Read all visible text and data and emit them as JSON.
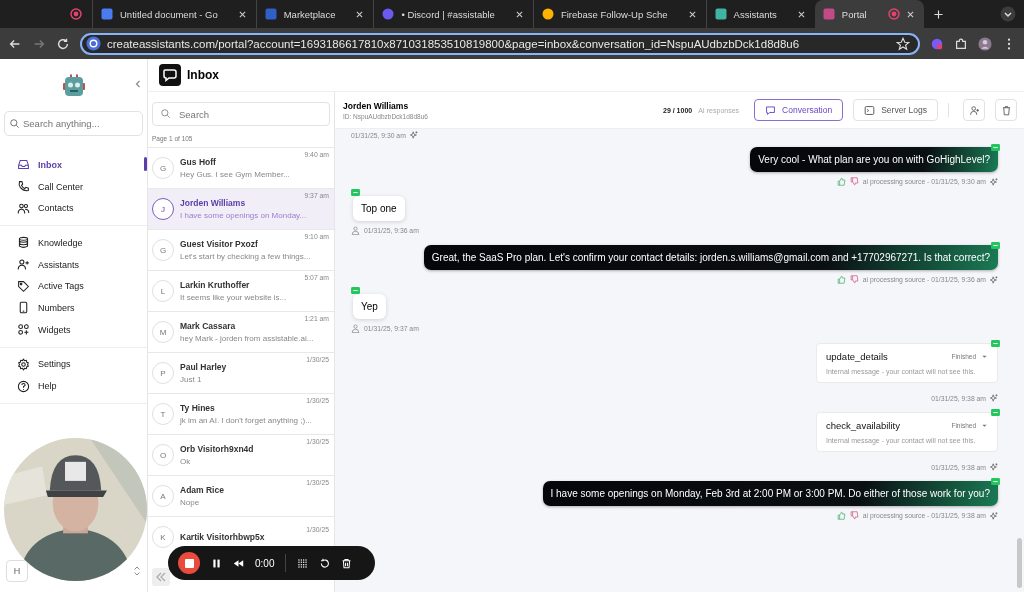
{
  "browser": {
    "tabs": [
      {
        "kind": "record",
        "selected": false
      },
      {
        "kind": "doc",
        "title": "Untitled document - Go",
        "selected": false
      },
      {
        "kind": "store",
        "title": "Marketplace",
        "selected": false
      },
      {
        "kind": "chat",
        "title": "• Discord | #assistable",
        "selected": false
      },
      {
        "kind": "fire",
        "title": "Firebase Follow-Up Sche",
        "selected": false
      },
      {
        "kind": "bot",
        "title": "Assistants",
        "selected": false
      },
      {
        "kind": "portal",
        "title": "Portal",
        "selected": true
      }
    ],
    "url": "createassistants.com/portal?account=1693186617810x871031853510819800&page=inbox&conversation_id=NspuAUdbzbDck1d8d8u6"
  },
  "sidebar": {
    "search": {
      "placeholder": "Search anything..."
    },
    "groups": [
      [
        {
          "label": "Inbox",
          "selected": true
        },
        {
          "label": "Call Center",
          "selected": false
        },
        {
          "label": "Contacts",
          "selected": false
        }
      ],
      [
        {
          "label": "Knowledge",
          "selected": false
        },
        {
          "label": "Assistants",
          "selected": false
        },
        {
          "label": "Active Tags",
          "selected": false
        },
        {
          "label": "Numbers",
          "selected": false
        },
        {
          "label": "Widgets",
          "selected": false
        }
      ],
      [
        {
          "label": "Settings",
          "selected": false
        },
        {
          "label": "Help",
          "selected": false
        }
      ]
    ],
    "workspace": {
      "initial": "H"
    }
  },
  "inbox": {
    "title": "Inbox",
    "search": {
      "placeholder": "Search"
    },
    "page": "Page 1 of 105",
    "conversations": [
      {
        "initial": "G",
        "name": "Gus Hoff",
        "preview": "Hey Gus. I see Gym Member...",
        "time": "9:40 am",
        "selected": false
      },
      {
        "initial": "J",
        "name": "Jorden Williams",
        "preview": "I have some openings on Monday...",
        "time": "9:37 am",
        "selected": true
      },
      {
        "initial": "G",
        "name": "Guest Visitor Pxozf",
        "preview": "Let's start by checking a few things...",
        "time": "9:10 am",
        "selected": false
      },
      {
        "initial": "L",
        "name": "Larkin Kruthoffer",
        "preview": "It seems like your website is...",
        "time": "5:07 am",
        "selected": false
      },
      {
        "initial": "M",
        "name": "Mark Cassara",
        "preview": "hey Mark - jorden from assistable.ai...",
        "time": "1:21 am",
        "selected": false
      },
      {
        "initial": "P",
        "name": "Paul Harley",
        "preview": "Just 1",
        "time": "1/30/25",
        "selected": false
      },
      {
        "initial": "T",
        "name": "Ty Hines",
        "preview": "jk im an AI. I don't forget anything ;)...",
        "time": "1/30/25",
        "selected": false
      },
      {
        "initial": "O",
        "name": "Orb Visitorh9xn4d",
        "preview": "Ok",
        "time": "1/30/25",
        "selected": false
      },
      {
        "initial": "A",
        "name": "Adam Rice",
        "preview": "Nope",
        "time": "1/30/25",
        "selected": false
      },
      {
        "initial": "K",
        "name": "Kartik Visitorhbwp5x",
        "time": "1/30/25",
        "selected": false
      }
    ]
  },
  "chat": {
    "name": "Jorden Williams",
    "id": "ID: NspuAUdbzbDck1d8d8u6",
    "usage": "29 / 1000",
    "usage_label": "AI responses",
    "tabs": [
      {
        "label": "Conversation",
        "selected": true
      },
      {
        "label": "Server Logs",
        "selected": false
      }
    ],
    "messages": [
      {
        "kind": "stamp",
        "time": "01/31/25, 9:30 am"
      },
      {
        "kind": "outgoing",
        "text": "Very cool - What plan are you on with GoHighLevel?",
        "meta": "ai processing source - 01/31/25, 9:30 am"
      },
      {
        "kind": "incoming",
        "text": "Top one",
        "time": "01/31/25, 9:36 am"
      },
      {
        "kind": "outgoing",
        "text": "Great, the SaaS Pro plan. Let's confirm your contact details: jorden.s.williams@gmail.com and +17702967271. Is that correct?",
        "meta": "ai processing source - 01/31/25, 9:36 am"
      },
      {
        "kind": "incoming",
        "text": "Yep",
        "time": "01/31/25, 9:37 am"
      },
      {
        "kind": "tool",
        "name": "update_details",
        "status": "Finished",
        "note": "Internal message - your contact will not see this.",
        "time": "01/31/25, 9:38 am"
      },
      {
        "kind": "tool",
        "name": "check_availability",
        "status": "Finished",
        "note": "Internal message - your contact will not see this.",
        "time": "01/31/25, 9:38 am"
      },
      {
        "kind": "outgoing",
        "text": "I have some openings on Monday, Feb 3rd at 2:00 PM or 3:00 PM. Do either of those work for you?",
        "meta": "ai processing source - 01/31/25, 9:38 am"
      }
    ]
  },
  "recorder": {
    "time": "0:00"
  }
}
